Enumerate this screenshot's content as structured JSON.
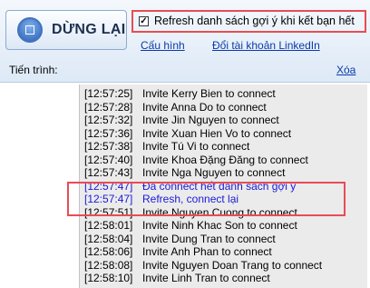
{
  "toolbar": {
    "stop_label": "DỪNG LẠI",
    "refresh_checkbox": {
      "checked": true,
      "label": "Refresh danh sách gợi ý khi kết bạn hết"
    },
    "config_link": "Cấu hình",
    "switch_account_link": "Đổi tài khoản LinkedIn",
    "progress_label": "Tiến trình:",
    "clear_link": "Xóa"
  },
  "log": [
    {
      "time": "[12:57:25]",
      "message": "Invite Kerry Bien to connect",
      "highlight": false
    },
    {
      "time": "[12:57:28]",
      "message": "Invite Anna Do to connect",
      "highlight": false
    },
    {
      "time": "[12:57:32]",
      "message": "Invite Jin Nguyen to connect",
      "highlight": false
    },
    {
      "time": "[12:57:36]",
      "message": "Invite Xuan Hien Vo to connect",
      "highlight": false
    },
    {
      "time": "[12:57:38]",
      "message": "Invite Tú Vi to connect",
      "highlight": false
    },
    {
      "time": "[12:57:40]",
      "message": "Invite Khoa Đặng Đăng to connect",
      "highlight": false
    },
    {
      "time": "[12:57:43]",
      "message": "Invite Nga Nguyen to connect",
      "highlight": false
    },
    {
      "time": "[12:57:47]",
      "message": "Đã connect hết danh sách gợi ý",
      "highlight": true
    },
    {
      "time": "[12:57:47]",
      "message": "Refresh, connect lại",
      "highlight": true
    },
    {
      "time": "[12:57:51]",
      "message": "Invite Nguyen Cuong to connect",
      "highlight": false
    },
    {
      "time": "[12:58:01]",
      "message": "Invite Ninh Khac Son to connect",
      "highlight": false
    },
    {
      "time": "[12:58:04]",
      "message": "Invite Dung Tran to connect",
      "highlight": false
    },
    {
      "time": "[12:58:06]",
      "message": "Invite Anh Phan to connect",
      "highlight": false
    },
    {
      "time": "[12:58:08]",
      "message": "Invite Nguyen Doan Trang to connect",
      "highlight": false
    },
    {
      "time": "[12:58:10]",
      "message": "Invite Linh Tran to connect",
      "highlight": false
    }
  ],
  "colors": {
    "highlight_text": "#1a1ad8",
    "annotation_border": "#e84c55",
    "link": "#0b3aa8"
  }
}
